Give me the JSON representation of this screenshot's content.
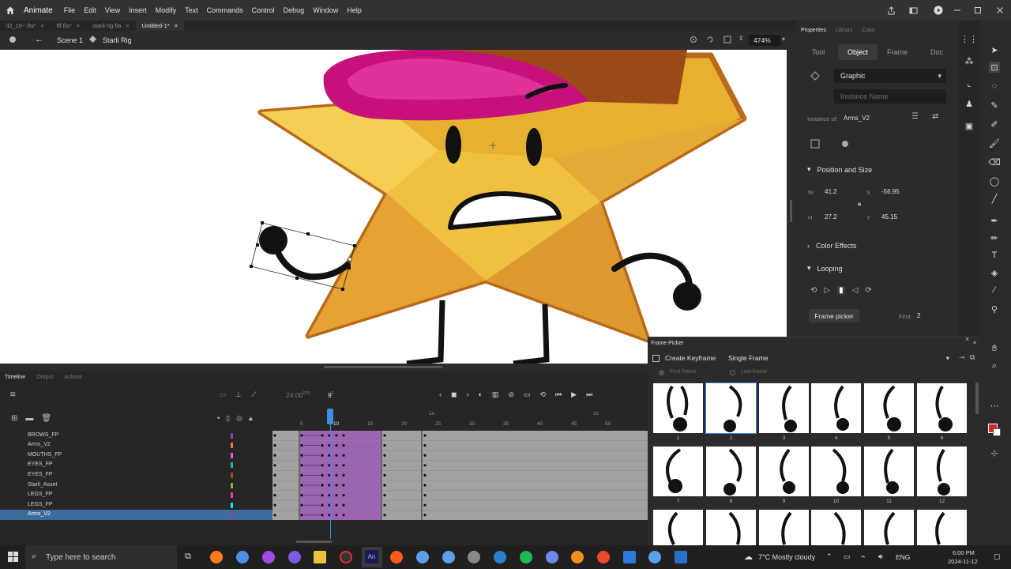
{
  "app": {
    "name": "Animate"
  },
  "menu": [
    "File",
    "Edit",
    "View",
    "Insert",
    "Modify",
    "Text",
    "Commands",
    "Control",
    "Debug",
    "Window",
    "Help"
  ],
  "doc_tabs": [
    {
      "label": "ll2_16~.fla*",
      "active": false
    },
    {
      "label": "fff.fla*",
      "active": false
    },
    {
      "label": "starli rig.fla",
      "active": false
    },
    {
      "label": "Untitled-1*",
      "active": true
    }
  ],
  "editbar": {
    "scene": "Scene 1",
    "symbol": "Starli Rig",
    "zoom": "474%"
  },
  "properties": {
    "tabs": [
      "Properties",
      "Library",
      "Color"
    ],
    "subtabs": [
      "Tool",
      "Object",
      "Frame",
      "Doc"
    ],
    "symbol_type": "Graphic",
    "instance_name_placeholder": "Instance Name",
    "instance_of_label": "Instance of:",
    "instance_of": "Arms_V2",
    "position_size": {
      "title": "Position and Size",
      "w_label": "W",
      "w": "41.2",
      "x_label": "X",
      "x": "-56.95",
      "h_label": "H",
      "h": "27.2",
      "y_label": "Y",
      "y": "45.15"
    },
    "color_effects": "Color Effects",
    "looping": "Looping",
    "frame_picker_button": "Frame picker",
    "first_label": "First",
    "first_value": "2"
  },
  "timeline": {
    "tabs": [
      "Timeline",
      "Output",
      "Actions"
    ],
    "fps": "24.00",
    "fps_unit": "FPS",
    "current_frame": "9",
    "frame_unit": "F",
    "ruler": [
      "5",
      "10",
      "15",
      "20",
      "25",
      "30",
      "35",
      "40",
      "45",
      "50"
    ],
    "seconds": [
      "1s",
      "2s"
    ],
    "layers": [
      {
        "name": "BROWS_FP",
        "color": "#8e44ad"
      },
      {
        "name": "Arms_V2",
        "color": "#e67e22"
      },
      {
        "name": "MOUTHS_FP",
        "color": "#d35fd3"
      },
      {
        "name": "EYES_FP",
        "color": "#1abc9c"
      },
      {
        "name": "EYES_FP",
        "color": "#c0392b"
      },
      {
        "name": "Starli_Asset",
        "color": "#7cb342"
      },
      {
        "name": "LEGS_FP",
        "color": "#e84393"
      },
      {
        "name": "LEGS_FP",
        "color": "#00e5ff"
      },
      {
        "name": "Arms_V2",
        "color": "#8e44ad",
        "selected": true
      }
    ]
  },
  "frame_picker": {
    "title": "Frame Picker",
    "create_keyframe": "Create Keyframe",
    "mode": "Single Frame",
    "first_frame": "First frame",
    "last_frame": "Last frame",
    "thumbs": [
      "1",
      "2",
      "3",
      "4",
      "5",
      "6",
      "7",
      "8",
      "9",
      "10",
      "11",
      "12"
    ]
  },
  "taskbar": {
    "search_placeholder": "Type here to search",
    "weather": "7°C  Mostly cloudy",
    "lang": "ENG",
    "time": "6:00 PM",
    "date": "2024-11-12"
  },
  "colors": {
    "accent": "#3d6c9c",
    "stroke": "#e02020",
    "playhead": "#3a8ee6"
  }
}
